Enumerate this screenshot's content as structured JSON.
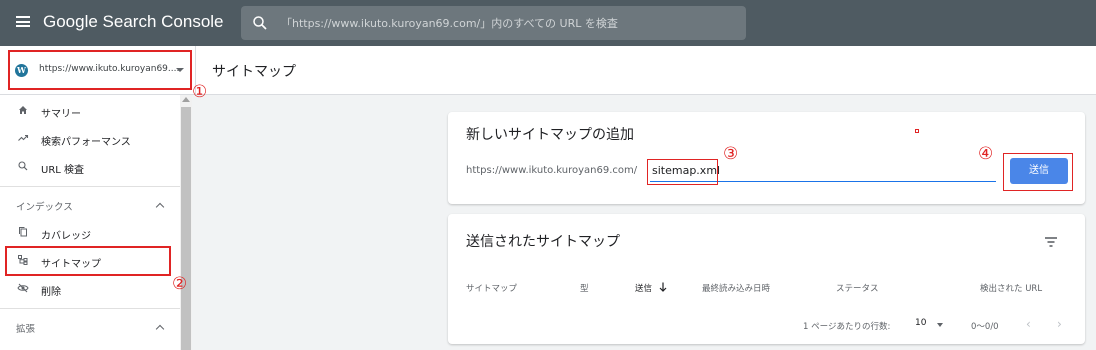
{
  "header": {
    "app_title": "Google Search Console",
    "search_placeholder": "「https://www.ikuto.kuroyan69.com/」内のすべての URL を検査"
  },
  "property": {
    "label": "https://www.ikuto.kuroyan69....",
    "icon": "wordpress-icon"
  },
  "page_title": "サイトマップ",
  "sidebar": {
    "items_top": [
      {
        "label": "サマリー",
        "icon": "home-icon"
      },
      {
        "label": "検索パフォーマンス",
        "icon": "trending-icon"
      },
      {
        "label": "URL 検査",
        "icon": "search-icon"
      }
    ],
    "section_index": "インデックス",
    "items_index": [
      {
        "label": "カバレッジ",
        "icon": "copy-icon"
      },
      {
        "label": "サイトマップ",
        "icon": "sitemap-icon"
      },
      {
        "label": "削除",
        "icon": "eye-off-icon"
      }
    ],
    "section_extensions": "拡張"
  },
  "add_sitemap": {
    "title": "新しいサイトマップの追加",
    "url_prefix": "https://www.ikuto.kuroyan69.com/",
    "input_value": "sitemap.xml",
    "submit_label": "送信"
  },
  "submitted": {
    "title": "送信されたサイトマップ",
    "columns": [
      "サイトマップ",
      "型",
      "送信",
      "最終読み込み日時",
      "ステータス",
      "検出された URL"
    ],
    "rows_per_page_label": "1 ページあたりの行数:",
    "rows_per_page_value": "10",
    "range": "0〜0/0",
    "prev": "‹",
    "next": "›"
  },
  "annotations": [
    "①",
    "②",
    "③",
    "④"
  ],
  "colors": {
    "header_bg": "#4f5b62",
    "accent": "#1a73e8",
    "submit_bg": "#4a86e8",
    "annotation_red": "#e02424"
  }
}
